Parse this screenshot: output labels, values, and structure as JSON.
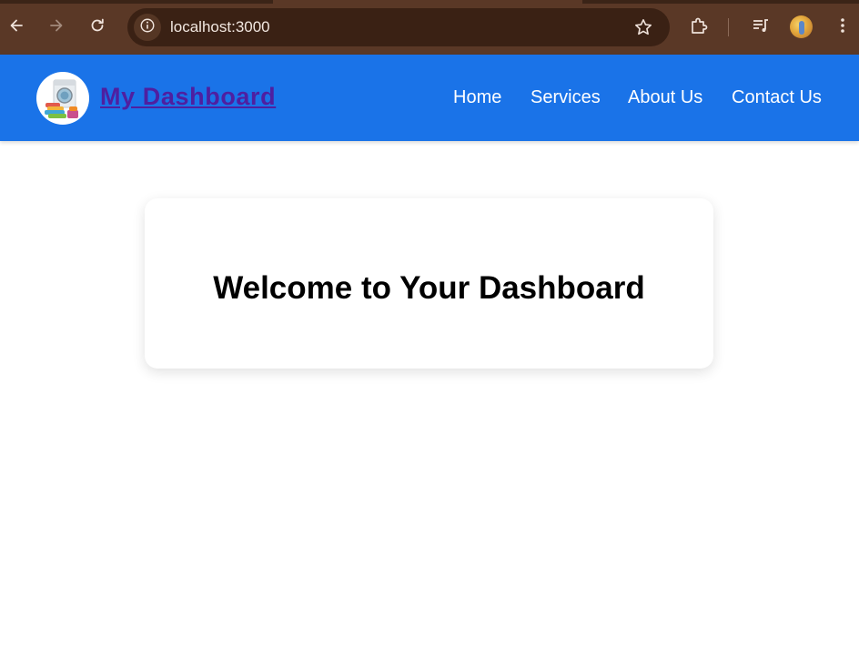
{
  "browser": {
    "url": "localhost:3000",
    "icons": {
      "back": "arrow-left-icon",
      "forward": "arrow-right-icon",
      "reload": "reload-icon",
      "site_info": "info-icon",
      "bookmark": "star-icon",
      "extensions": "puzzle-icon",
      "media": "media-controls-icon",
      "profile": "profile-avatar",
      "menu": "kebab-menu-icon"
    },
    "colors": {
      "frame": "#5a3826",
      "omnibox": "#3a2114"
    }
  },
  "header": {
    "brand": "My Dashboard",
    "logo_icon": "laundry-machine-logo",
    "nav": [
      {
        "label": "Home"
      },
      {
        "label": "Services"
      },
      {
        "label": "About Us"
      },
      {
        "label": "Contact Us"
      }
    ],
    "colors": {
      "background": "#1a73e8",
      "brand_link": "#4f1fa0",
      "nav_text": "#ffffff"
    }
  },
  "main": {
    "card_title": "Welcome to Your Dashboard"
  }
}
